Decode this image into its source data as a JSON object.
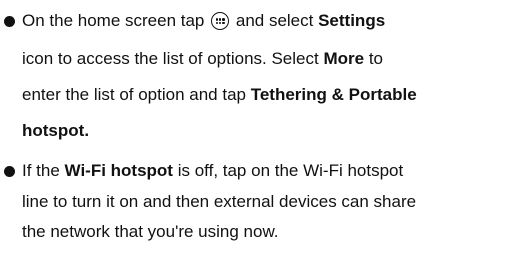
{
  "bullets": [
    {
      "line1": {
        "pre": "On the home screen tap",
        "icon": "apps-grid-icon",
        "mid": "and select",
        "bold": "Settings"
      },
      "line2": {
        "pre": "icon to access the list of options. Select",
        "bold": "More",
        "post": "to"
      },
      "line3": {
        "pre": "enter the list of option and tap",
        "bold": "Tethering & Portable"
      },
      "line4": {
        "bold": "hotspot."
      }
    },
    {
      "line1": {
        "pre": "If the",
        "bold": "Wi-Fi hotspot",
        "post": "is off, tap on the Wi-Fi hotspot"
      },
      "line2": {
        "text": "line to turn it on and then external devices can share"
      },
      "line3": {
        "text": "the network that you're using now."
      }
    }
  ]
}
